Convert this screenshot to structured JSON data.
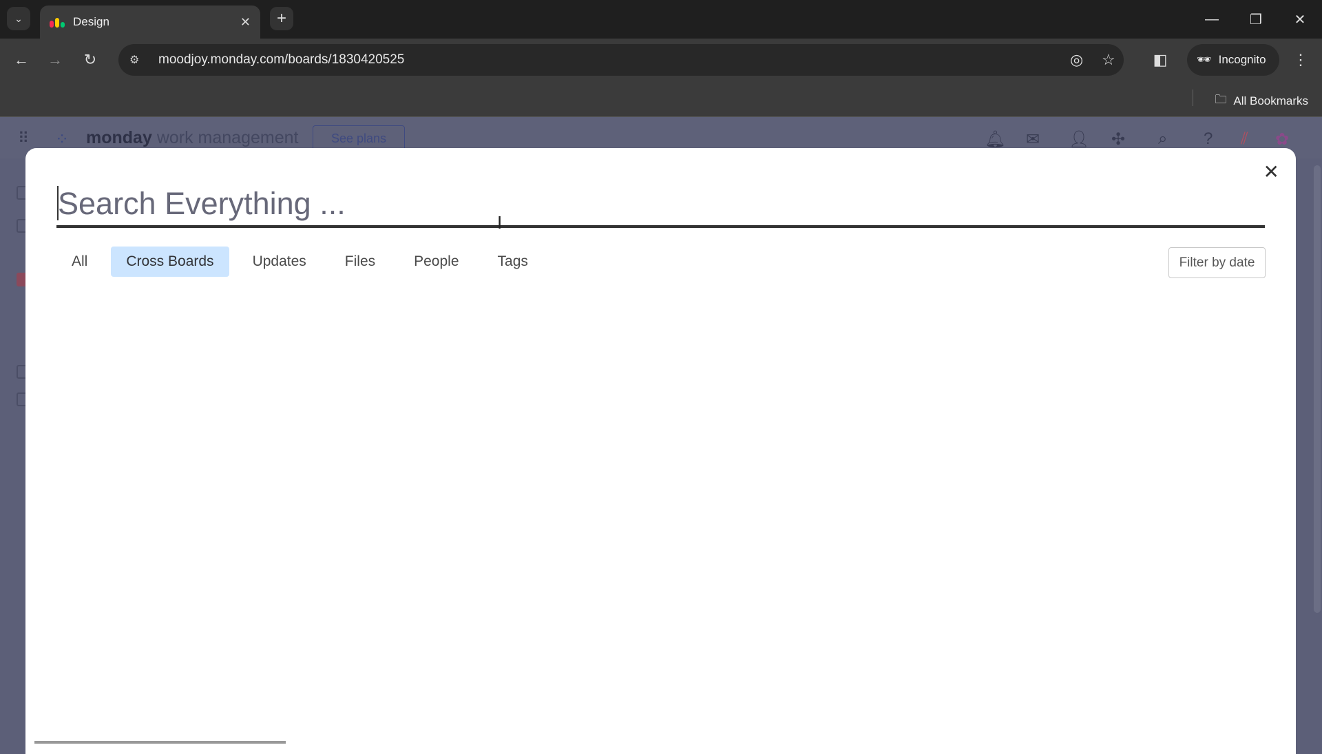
{
  "browser": {
    "tab_title": "Design",
    "url": "moodjoy.monday.com/boards/1830420525",
    "profile_label": "Incognito",
    "bookmarks_label": "All Bookmarks"
  },
  "app_header": {
    "brand": "monday",
    "product": "work management",
    "see_plans": "See plans"
  },
  "search_modal": {
    "placeholder": "Search Everything ...",
    "tabs": [
      {
        "label": "All",
        "active": false
      },
      {
        "label": "Cross Boards",
        "active": true
      },
      {
        "label": "Updates",
        "active": false
      },
      {
        "label": "Files",
        "active": false
      },
      {
        "label": "People",
        "active": false
      },
      {
        "label": "Tags",
        "active": false
      }
    ],
    "filter_by_date": "Filter by date"
  },
  "colors": {
    "active_tab_bg": "#cce5ff",
    "overlay": "#5c5f78"
  }
}
